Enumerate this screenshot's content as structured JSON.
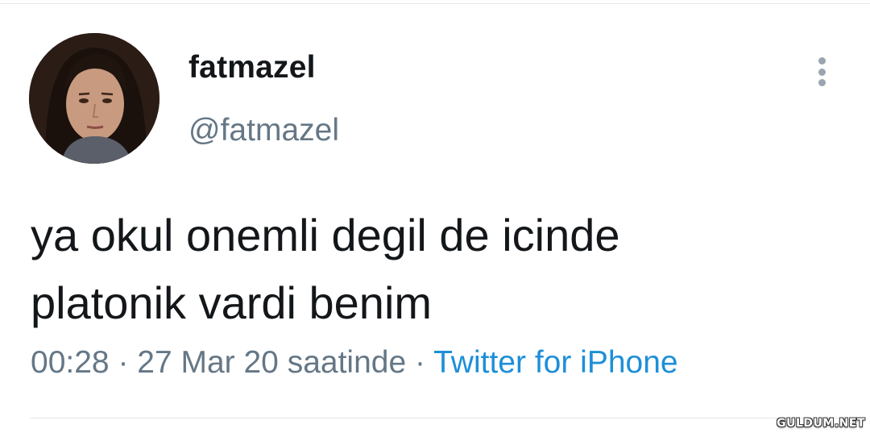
{
  "tweet": {
    "display_name": "fatmazel",
    "handle": "@fatmazel",
    "text_lines": [
      "ya okul onemli degil de icinde",
      "platonik vardi benim"
    ],
    "time": "00:28",
    "separator": " · ",
    "date": "27 Mar 20 saatinde",
    "source": "Twitter for iPhone",
    "more_icon": "more-vertical-icon"
  },
  "watermark": "GULDUM.NET",
  "colors": {
    "text": "#14171a",
    "secondary": "#657786",
    "link": "#1d8fd8",
    "divider": "#e1e6ea"
  }
}
